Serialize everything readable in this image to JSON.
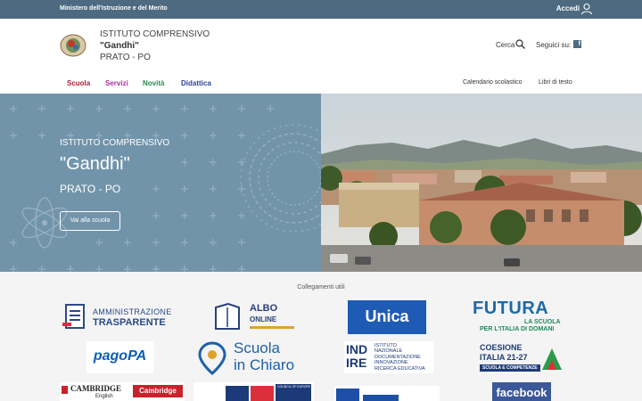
{
  "topbar": {
    "ministry": "Ministero dell'Istruzione e del Merito",
    "login": "Accedi"
  },
  "header": {
    "school_line1": "ISTITUTO COMPRENSIVO",
    "school_line2": "\"Gandhi\"",
    "school_line3": "PRATO - PO",
    "search_label": "Cerca",
    "social_label": "Seguici su:",
    "facebook_glyph": "f"
  },
  "nav": {
    "items": [
      "Scuola",
      "Servizi",
      "Novità",
      "Didattica"
    ],
    "right": [
      "Calendario scolastico",
      "Libri di testo"
    ]
  },
  "hero": {
    "line1": "ISTITUTO COMPRENSIVO",
    "line2": "\"Gandhi\"",
    "line3": "PRATO - PO",
    "button": "Vai alla scuola"
  },
  "links": {
    "title": "Collegamenti utili",
    "amministrazione": {
      "line1": "AMMINISTRAZIONE",
      "line2": "TRASPARENTE"
    },
    "albo": {
      "line1": "ALBO",
      "line2": "ONLINE"
    },
    "unica": "Unica",
    "futura": {
      "line1": "FUTURA",
      "line2": "LA SCUOLA",
      "line3": "PER L'ITALIA DI DOMANI"
    },
    "pagopa": "pagoPA",
    "scuola_chiaro": {
      "line1": "Scuola",
      "line2": "in Chiaro"
    },
    "indire": {
      "logo1": "IND",
      "logo2": "IRE",
      "l1": "ISTITUTO",
      "l2": "NAZIONALE",
      "l3": "DOCUMENTAZIONE",
      "l4": "INNOVAZIONE",
      "l5": "RICERCA EDUCATIVA"
    },
    "coesione": {
      "line1": "COESIONE",
      "line2": "ITALIA 21-27",
      "line3": "SCUOLA E COMPETENZE"
    },
    "cambridge": {
      "word": "CAMBRIDGE",
      "sub": "English",
      "badge": "Cambridge"
    },
    "coe": "COUNCIL OF EUROPE",
    "facebook": "facebook"
  },
  "colors": {
    "topbar": "#4d6a80",
    "hero_panel": "#7294ab",
    "nav_scuola": "#b01e3c",
    "nav_servizi": "#b02aa0",
    "nav_novita": "#2a8a52",
    "nav_didattica": "#2b3f9e"
  }
}
